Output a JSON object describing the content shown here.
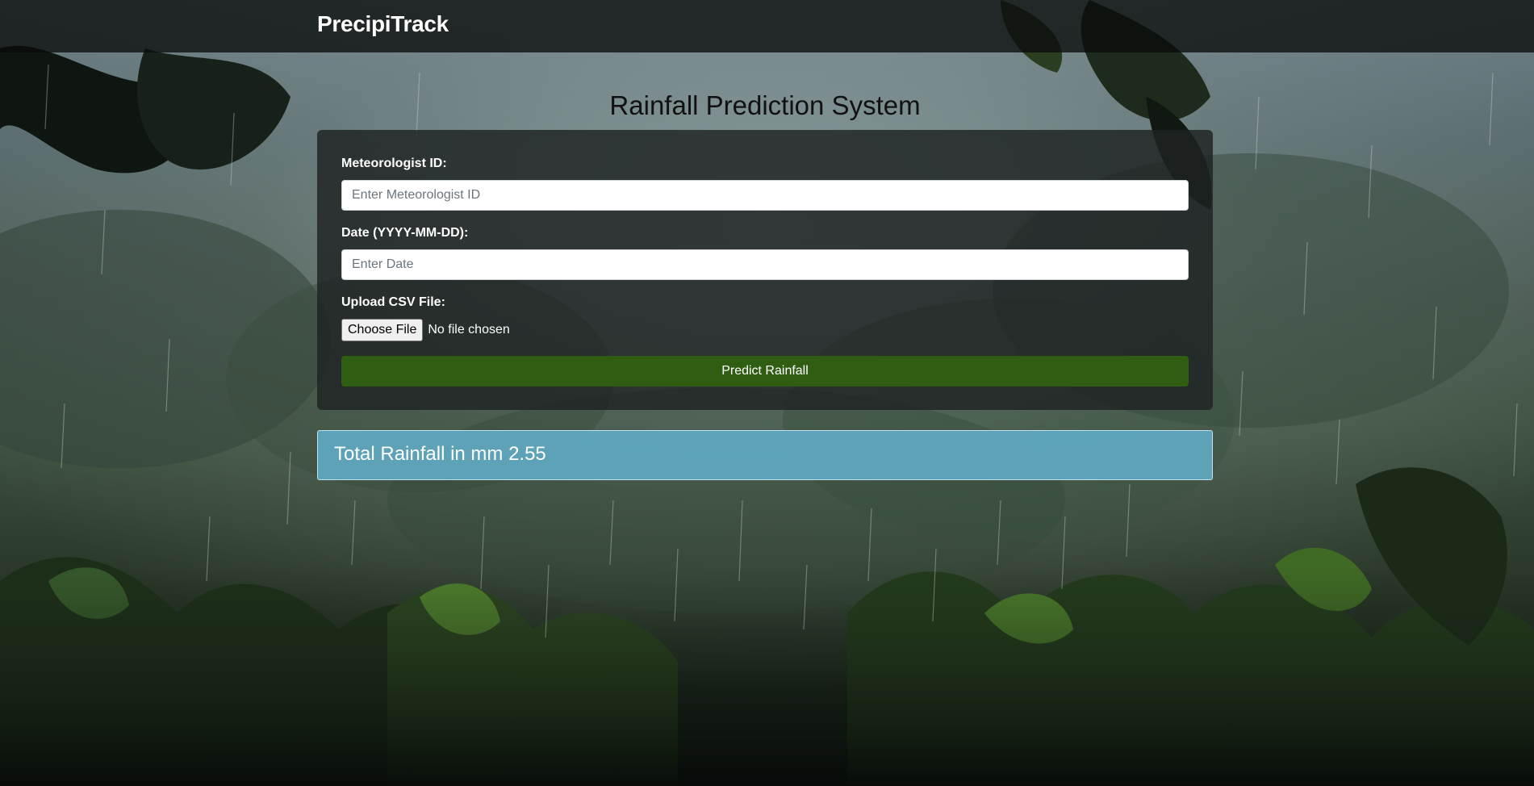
{
  "navbar": {
    "brand": "PrecipiTrack"
  },
  "page": {
    "title": "Rainfall Prediction System"
  },
  "form": {
    "meteorologist_label": "Meteorologist ID:",
    "meteorologist_placeholder": "Enter Meteorologist ID",
    "meteorologist_value": "",
    "date_label": "Date (YYYY-MM-DD):",
    "date_placeholder": "Enter Date",
    "date_value": "",
    "upload_label": "Upload CSV File:",
    "choose_file_label": "Choose File",
    "file_status": "No file chosen",
    "predict_label": "Predict Rainfall"
  },
  "result": {
    "text": "Total Rainfall in mm 2.55"
  },
  "colors": {
    "navbar_bg": "#0a0c0c",
    "card_bg": "#1e2222",
    "predict_button": "#2f5e12",
    "result_bg": "#5fa7be"
  },
  "background": {
    "image": "rainforest-rain-icon"
  }
}
